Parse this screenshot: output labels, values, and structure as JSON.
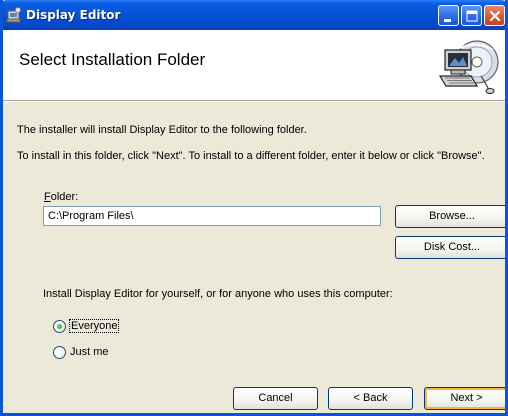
{
  "window": {
    "title": "Display Editor"
  },
  "header": {
    "title": "Select Installation Folder",
    "graphic_icon": "computer-disc-icon"
  },
  "body": {
    "line1": "The installer will install Display Editor to the following folder.",
    "line2": "To install in this folder, click \"Next\". To install to a different folder, enter it below or click \"Browse\".",
    "folder_label_accel": "F",
    "folder_label_rest": "older:",
    "folder_value": "C:\\Program Files\\",
    "browse_label": "Browse...",
    "disk_cost_label": "Disk Cost...",
    "install_for_label": "Install Display Editor for yourself, or for anyone who uses this computer:",
    "radio_everyone": "Everyone",
    "radio_just_me": "Just me",
    "selected_option": "Everyone"
  },
  "footer": {
    "cancel_label": "Cancel",
    "back_label": "< Back",
    "next_label": "Next >"
  },
  "colors": {
    "titlebar": "#0651d8",
    "dialog_bg": "#ece9d8",
    "default_button_highlight": "#f8b33c"
  }
}
